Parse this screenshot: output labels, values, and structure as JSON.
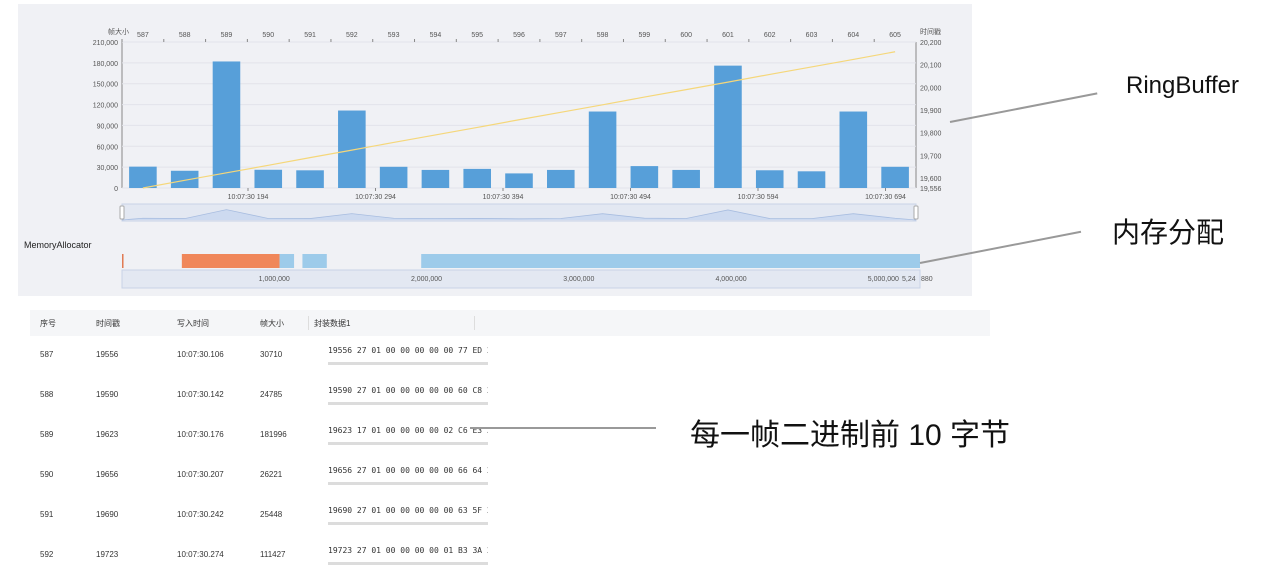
{
  "chart_data": {
    "type": "bar",
    "categories": [
      "587",
      "588",
      "589",
      "590",
      "591",
      "592",
      "593",
      "594",
      "595",
      "596",
      "597",
      "598",
      "599",
      "600",
      "601",
      "602",
      "603",
      "604",
      "605"
    ],
    "series": [
      {
        "name": "帧大小",
        "type": "bar",
        "values": [
          30710,
          24785,
          181996,
          26221,
          25448,
          111427,
          30500,
          26000,
          27500,
          21000,
          26000,
          110000,
          31500,
          26000,
          176000,
          25500,
          24000,
          110000,
          30500
        ]
      },
      {
        "name": "时间戳",
        "type": "line",
        "values": [
          19556,
          19590,
          19623,
          19656,
          19690,
          19723,
          19757,
          19790,
          19823,
          19857,
          19890,
          19923,
          19957,
          19990,
          20023,
          20057,
          20090,
          20123,
          20157
        ]
      }
    ],
    "ylabel_left": "帧大小",
    "ylabel_right": "时间戳",
    "ylim_left": [
      0,
      210000
    ],
    "ylim_right": [
      19556,
      20200
    ],
    "yticks_left": [
      "210,000",
      "180,000",
      "150,000",
      "120,000",
      "90,000",
      "60,000",
      "30,000",
      "0"
    ],
    "yticks_right": [
      "20,200",
      "20,100",
      "20,000",
      "19,900",
      "19,800",
      "19,700",
      "19,600",
      "19,556"
    ],
    "time_labels": [
      "10:07:30 194",
      "10:07:30 294",
      "10:07:30 394",
      "10:07:30 494",
      "10:07:30 594",
      "10:07:30 694"
    ],
    "colors": {
      "bar": "#579fd9",
      "line": "#f5d77a"
    }
  },
  "memory": {
    "title": "MemoryAllocator",
    "ticks": [
      "1,000,000",
      "2,000,000",
      "3,000,000",
      "4,000,000",
      "5,000,000"
    ],
    "end_label": "5,24",
    "end_label2": "880",
    "max": 5240880,
    "blocks": [
      {
        "start": 0,
        "end": 10000,
        "color": "#e07b54"
      },
      {
        "start": 393000,
        "end": 1035000,
        "color": "#f0875a"
      },
      {
        "start": 1035000,
        "end": 1130000,
        "color": "#9dcbea"
      },
      {
        "start": 1185000,
        "end": 1345000,
        "color": "#9dcbea"
      },
      {
        "start": 1965000,
        "end": 5240880,
        "color": "#9dcbea"
      }
    ]
  },
  "table": {
    "headers": [
      "序号",
      "时间戳",
      "写入时间",
      "帧大小",
      "封装数据1"
    ],
    "rows": [
      {
        "seq": "587",
        "ts": "19556",
        "time": "10:07:30.106",
        "size": "30710",
        "hex": "19556 27 01 00 00 00 00 00 77 ED 2"
      },
      {
        "seq": "588",
        "ts": "19590",
        "time": "10:07:30.142",
        "size": "24785",
        "hex": "19590 27 01 00 00 00 00 00 60 C8 2"
      },
      {
        "seq": "589",
        "ts": "19623",
        "time": "10:07:30.176",
        "size": "181996",
        "hex": "19623 17 01 00 00 00 00 02 C6 E3 3"
      },
      {
        "seq": "590",
        "ts": "19656",
        "time": "10:07:30.207",
        "size": "26221",
        "hex": "19656 27 01 00 00 00 00 00 66 64 2"
      },
      {
        "seq": "591",
        "ts": "19690",
        "time": "10:07:30.242",
        "size": "25448",
        "hex": "19690 27 01 00 00 00 00 00 63 5F 2"
      },
      {
        "seq": "592",
        "ts": "19723",
        "time": "10:07:30.274",
        "size": "111427",
        "hex": "19723 27 01 00 00 00 00 01 B3 3A 2"
      }
    ]
  },
  "callouts": {
    "ringbuffer": "RingBuffer",
    "memory": "内存分配",
    "bytes": "每一帧二进制前 10 字节"
  }
}
